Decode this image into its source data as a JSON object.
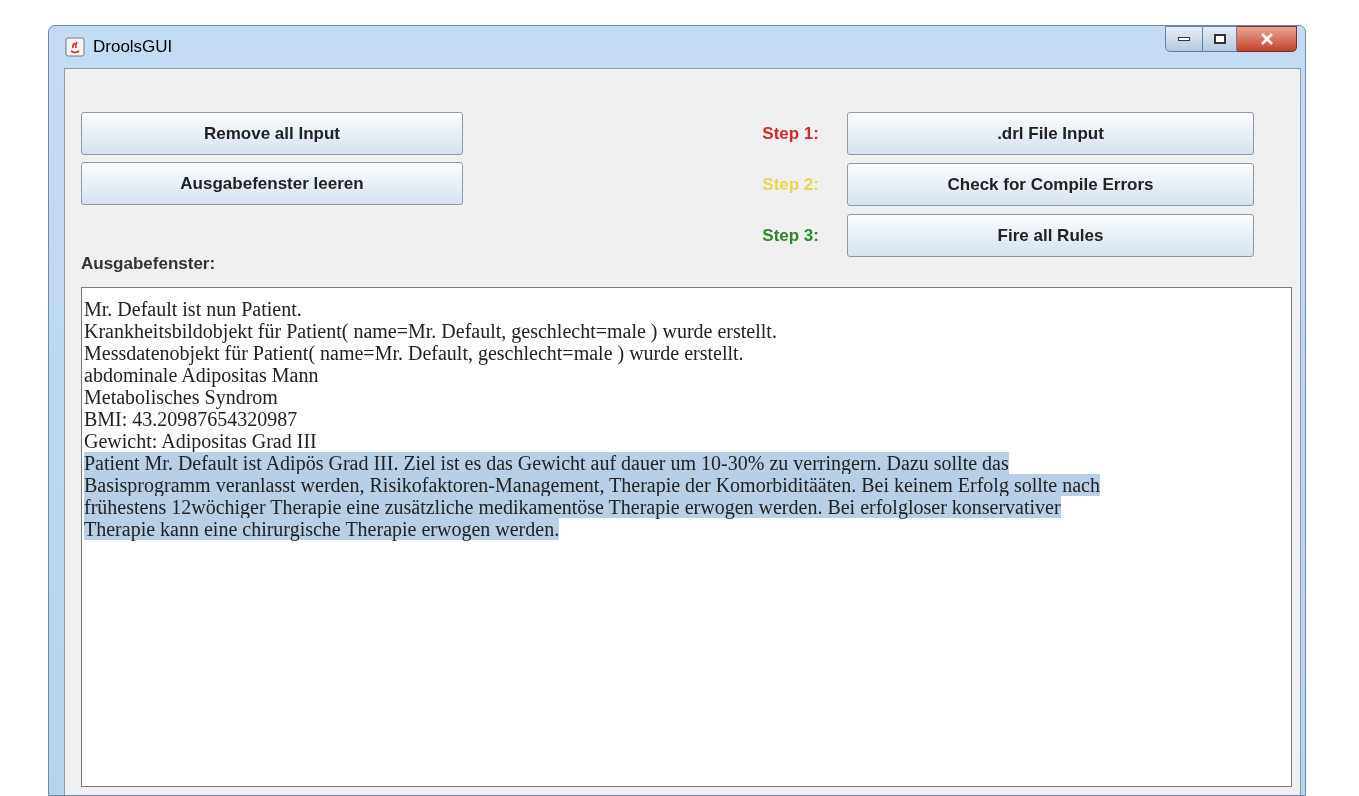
{
  "window": {
    "title": "DroolsGUI"
  },
  "left_buttons": [
    "Remove all Input",
    "Ausgabefenster leeren"
  ],
  "steps": [
    {
      "label": "Step 1:",
      "color": "#d42a2a",
      "button": ".drl File Input"
    },
    {
      "label": "Step 2:",
      "color": "#e6d84a",
      "button": "Check for Compile Errors"
    },
    {
      "label": "Step 3:",
      "color": "#2a8a2a",
      "button": "Fire all Rules"
    }
  ],
  "output_label": "Ausgabefenster:",
  "output_lines": [
    {
      "text": "Mr. Default ist nun Patient.",
      "selected": false
    },
    {
      "text": "Krankheitsbildobjekt für Patient( name=Mr. Default, geschlecht=male ) wurde erstellt.",
      "selected": false
    },
    {
      "text": "Messdatenobjekt für Patient( name=Mr. Default, geschlecht=male ) wurde erstellt.",
      "selected": false
    },
    {
      "text": "abdominale Adipositas Mann",
      "selected": false
    },
    {
      "text": "Metabolisches Syndrom",
      "selected": false
    },
    {
      "text": "BMI: 43.20987654320987",
      "selected": false
    },
    {
      "text": "Gewicht: Adipositas Grad III",
      "selected": false
    },
    {
      "text": "Patient Mr. Default ist Adipös Grad III. Ziel ist es das Gewicht auf dauer um 10-30% zu verringern. Dazu sollte das",
      "selected": true
    },
    {
      "text": "Basisprogramm veranlasst werden, Risikofaktoren-Management, Therapie der Komorbiditääten. Bei keinem Erfolg sollte nach",
      "selected": true
    },
    {
      "text": "frühestens 12wöchiger Therapie eine zusätzliche medikamentöse Therapie erwogen werden. Bei erfolgloser konservativer",
      "selected": true
    },
    {
      "text": "Therapie kann eine chirurgische Therapie erwogen werden.",
      "selected": true
    }
  ]
}
